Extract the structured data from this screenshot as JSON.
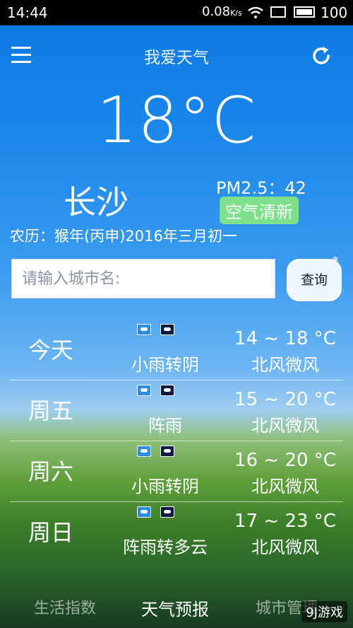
{
  "status": {
    "time": "14:44",
    "speed": "0.08",
    "speed_unit": "K/s",
    "battery": "100"
  },
  "header": {
    "title": "我爱天气"
  },
  "current": {
    "temperature": "18°C",
    "city": "长沙",
    "pm25": "PM2.5：42",
    "air_quality": "空气清新",
    "lunar": "农历：猴年(丙申)2016年三月初一"
  },
  "search": {
    "placeholder": "请输入城市名:",
    "button": "查询"
  },
  "forecast": [
    {
      "day": "今天",
      "condition": "小雨转阴",
      "temp_range": "14 ~ 18 °C",
      "wind": "北风微风"
    },
    {
      "day": "周五",
      "condition": "阵雨",
      "temp_range": "15 ~ 20 °C",
      "wind": "北风微风"
    },
    {
      "day": "周六",
      "condition": "小雨转阴",
      "temp_range": "16 ~ 20 °C",
      "wind": "北风微风"
    },
    {
      "day": "周日",
      "condition": "阵雨转多云",
      "temp_range": "17 ~ 23 °C",
      "wind": "北风微风"
    }
  ],
  "tabs": {
    "life": "生活指数",
    "forecast": "天气预报",
    "city": "城市管理"
  },
  "watermark": "9J游戏"
}
